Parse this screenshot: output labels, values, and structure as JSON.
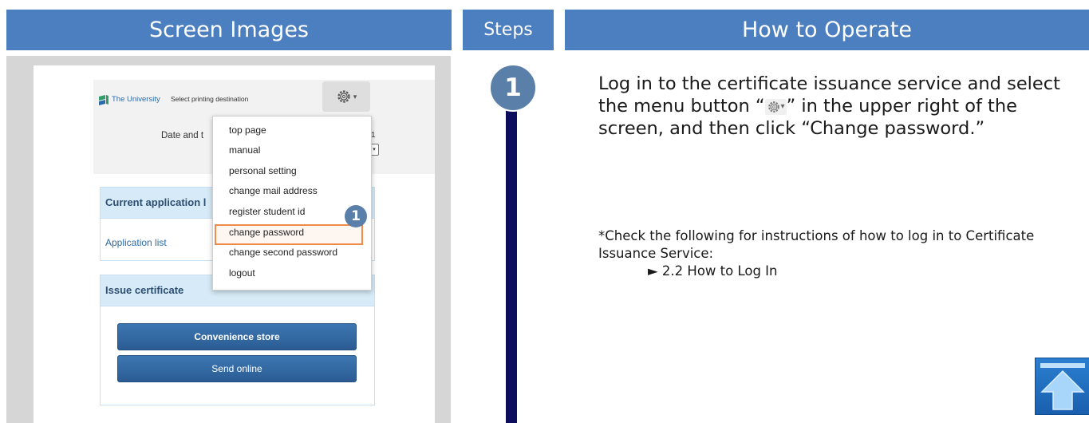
{
  "headers": {
    "screen_images": "Screen Images",
    "steps": "Steps",
    "how_to_operate": "How to Operate"
  },
  "screenshot": {
    "logo_text": "The University",
    "select_destination": "Select printing destination",
    "date_label": "Date and t",
    "date_fragment": "1",
    "date_box": "▾",
    "menu_button_caret": "▾",
    "menu": {
      "items": [
        "top page",
        "manual",
        "personal setting",
        "change mail address",
        "register student id",
        "change password",
        "change second password",
        "logout"
      ],
      "highlighted_index": 5
    },
    "current_application": {
      "title": "Current application l",
      "link": "Application list"
    },
    "issue_certificate": {
      "title": "Issue certificate",
      "buttons": [
        "Convenience store",
        "Send online"
      ]
    },
    "callout_number": "1"
  },
  "step_number": "1",
  "instruction": {
    "text_before_icon": "Log in to the certificate issuance service and select the menu button “",
    "text_after_icon": "” in the upper right of the screen, and then click “Change password.”",
    "icon_caret": "▾"
  },
  "note": {
    "line": "*Check the following for instructions of how to log in to Certificate Issuance Service:",
    "link": "► 2.2 How to Log In"
  },
  "colors": {
    "header_bg": "#4c7fbf",
    "step_line": "#0d0d5e",
    "badge": "#5a7fa8",
    "highlight": "#f08a4b",
    "button": "#2b5c93"
  }
}
